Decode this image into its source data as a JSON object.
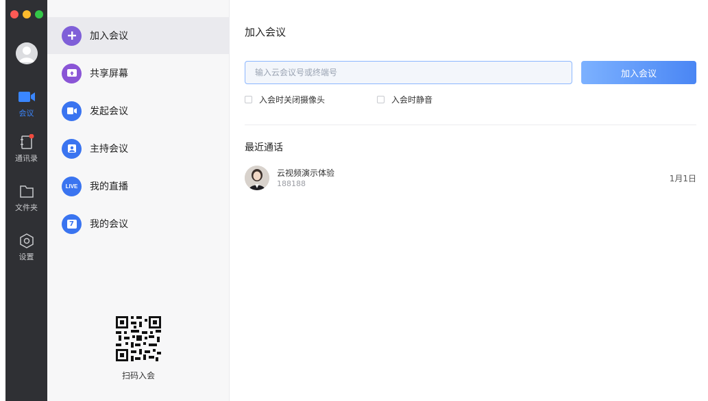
{
  "rail": {
    "items": [
      {
        "label": "会议",
        "icon": "video-camera-icon"
      },
      {
        "label": "通讯录",
        "icon": "contacts-icon"
      },
      {
        "label": "文件夹",
        "icon": "folder-icon"
      },
      {
        "label": "设置",
        "icon": "settings-icon"
      }
    ]
  },
  "menu": {
    "items": [
      {
        "label": "加入会议",
        "icon": "plus-icon",
        "color": "#7f5fd8"
      },
      {
        "label": "共享屏幕",
        "icon": "share-screen-icon",
        "color": "#8a55d6"
      },
      {
        "label": "发起会议",
        "icon": "video-camera-icon",
        "color": "#3a74f0"
      },
      {
        "label": "主持会议",
        "icon": "host-icon",
        "color": "#3a74f0"
      },
      {
        "label": "我的直播",
        "icon": "live-icon",
        "color": "#3a74f0"
      },
      {
        "label": "我的会议",
        "icon": "calendar-icon",
        "color": "#3a74f0"
      }
    ],
    "live_badge": "LIVE",
    "calendar_digit": "7",
    "qr_label": "扫码入会"
  },
  "content": {
    "title": "加入会议",
    "input_placeholder": "输入云会议号或终端号",
    "join_button": "加入会议",
    "options": [
      "入会时关闭摄像头",
      "入会时静音"
    ],
    "recent_title": "最近通话",
    "recent_calls": [
      {
        "name": "云视频演示体验",
        "number": "188188",
        "date": "1月1日"
      }
    ]
  },
  "colors": {
    "rail_bg": "#2f3034",
    "accent": "#3a86ff",
    "button_gradient_start": "#7cb1ff",
    "button_gradient_end": "#4a86f4"
  }
}
